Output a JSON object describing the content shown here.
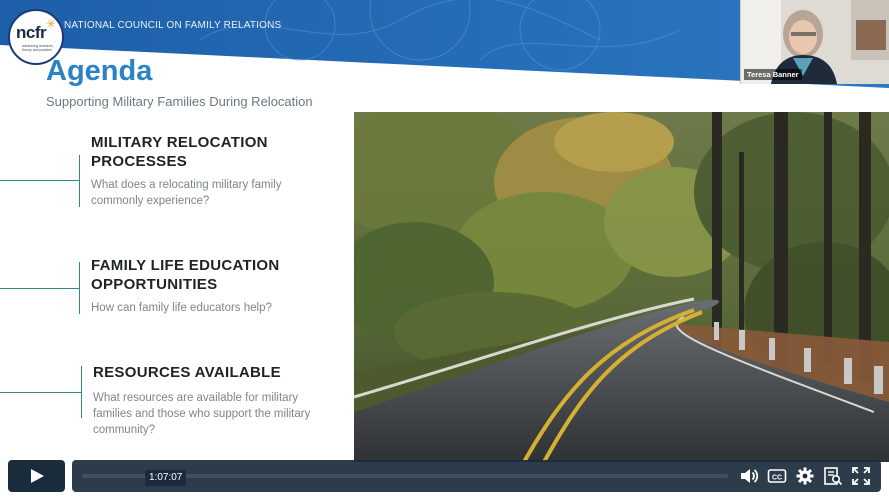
{
  "slide": {
    "banner_text": "NATIONAL COUNCIL ON FAMILY RELATIONS",
    "logo": {
      "name": "ncfr",
      "tagline": "advancing research, theory and practice"
    },
    "title": "Agenda",
    "subtitle": "Supporting Military Families During Relocation",
    "items": [
      {
        "title_line1": "MILITARY RELOCATION",
        "title_line2": "PROCESSES",
        "desc_line1": "What does a relocating military family",
        "desc_line2": "commonly experience?",
        "desc_line3": ""
      },
      {
        "title_line1": "FAMILY LIFE EDUCATION",
        "title_line2": "OPPORTUNITIES",
        "desc_line1": "How can family life educators help?",
        "desc_line2": "",
        "desc_line3": ""
      },
      {
        "title_line1": "RESOURCES AVAILABLE",
        "title_line2": "",
        "desc_line1": "What resources are available for military",
        "desc_line2": "families and those who support the military",
        "desc_line3": "community?"
      }
    ],
    "colors": {
      "banner": "#1f6bb5",
      "title": "#2a83c4",
      "accent_line": "#2e8b8b"
    }
  },
  "webcam": {
    "participant_name": "Teresa Banner"
  },
  "player": {
    "current_time": "1:07:07",
    "progress_fraction": 0.0,
    "icons": [
      "play-icon",
      "volume-icon",
      "captions-icon",
      "settings-icon",
      "transcript-icon",
      "fullscreen-icon"
    ],
    "accent": "#1a2b3c"
  }
}
